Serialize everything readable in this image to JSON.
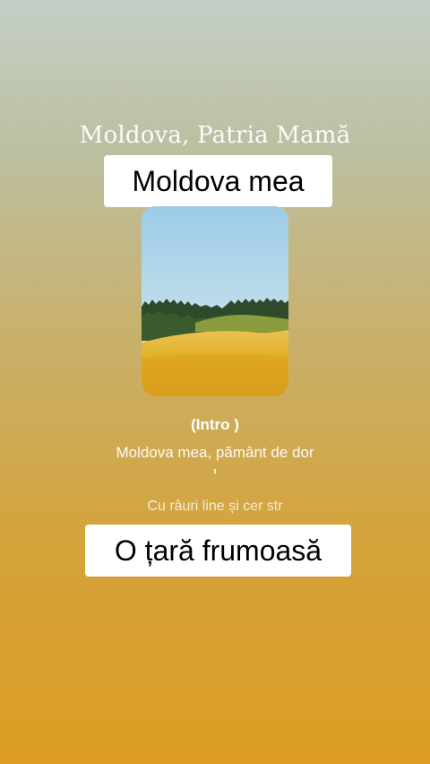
{
  "song": {
    "title": "Moldova, Patria Mamă"
  },
  "captions": {
    "top": "Moldova mea",
    "bottom": "O țară frumoasă"
  },
  "lyrics": {
    "section": "(Intro )",
    "line1": "Moldova mea, pământ de dor",
    "line2": "Cu râuri line și cer str"
  },
  "artwork": {
    "description_icon": "landscape-field-forest-icon"
  },
  "colors": {
    "background_top": "#c4cfc7",
    "background_bottom": "#dd9c22",
    "text": "#ffffff",
    "caption_bg": "#ffffff"
  }
}
